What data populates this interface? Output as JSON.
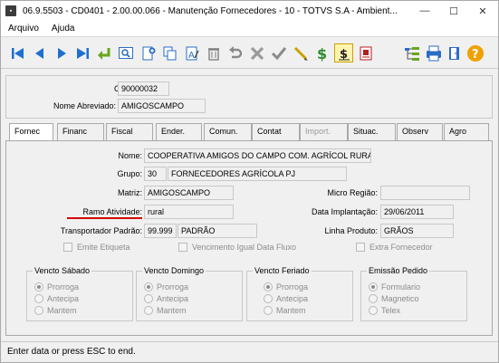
{
  "window": {
    "title": "06.9.5503 - CD0401 - 2.00.00.066 - Manutenção Fornecedores - 10 - TOTVS S.A - Ambient...",
    "minimize": "—",
    "maximize": "☐",
    "close": "✕"
  },
  "menu": {
    "items": [
      "Arquivo",
      "Ajuda"
    ]
  },
  "toolbar": {
    "icons": [
      "first-record-icon",
      "previous-record-icon",
      "next-record-icon",
      "last-record-icon",
      "goto-icon",
      "search-icon",
      "new-icon",
      "copy-icon",
      "edit-icon",
      "delete-icon",
      "undo-icon",
      "cancel-icon",
      "confirm-icon",
      "pen-icon",
      "dollar-icon",
      "currency-icon",
      "report-icon",
      "tree-icon",
      "print-icon",
      "exit-icon",
      "help-icon"
    ]
  },
  "header": {
    "codigo_label": "Código:",
    "codigo_value": "90000032",
    "nome_abrev_label": "Nome Abreviado:",
    "nome_abrev_value": "AMIGOSCAMPO"
  },
  "tabs": [
    "Fornec",
    "Financ",
    "Fiscal",
    "Ender.",
    "Comun.",
    "Contat",
    "Import.",
    "Situac.",
    "Observ",
    "Agro"
  ],
  "form": {
    "nome_label": "Nome:",
    "nome_value": "COOPERATIVA AMIGOS DO CAMPO COM. AGRÍCOL RURAL",
    "grupo_label": "Grupo:",
    "grupo_code": "30",
    "grupo_desc": "FORNECEDORES AGRÍCOLA PJ",
    "matriz_label": "Matriz:",
    "matriz_value": "AMIGOSCAMPO",
    "micro_regiao_label": "Micro Região:",
    "micro_regiao_value": "",
    "ramo_label": "Ramo Atividade:",
    "ramo_value": "rural",
    "data_impl_label": "Data Implantação:",
    "data_impl_value": "29/06/2011",
    "transp_label": "Transportador Padrão:",
    "transp_code": "99.999",
    "transp_desc": "PADRÃO",
    "linha_label": "Linha Produto:",
    "linha_value": "GRÃOS",
    "emite_etiqueta": "Emite Etiqueta",
    "venc_igual": "Vencimento Igual Data Fluxo",
    "extra_fornec": "Extra Fornecedor"
  },
  "groups": [
    {
      "title": "Vencto Sábado",
      "options": [
        "Prorroga",
        "Antecipa",
        "Mantem"
      ],
      "selected": 0
    },
    {
      "title": "Vencto Domingo",
      "options": [
        "Prorroga",
        "Antecipa",
        "Mantem"
      ],
      "selected": 0
    },
    {
      "title": "Vencto Feriado",
      "options": [
        "Prorroga",
        "Antecipa",
        "Mantem"
      ],
      "selected": 0
    },
    {
      "title": "Emissão Pedido",
      "options": [
        "Formulario",
        "Magnetico",
        "Telex"
      ],
      "selected": 0
    }
  ],
  "status": {
    "text": "Enter data or press ESC to end."
  }
}
